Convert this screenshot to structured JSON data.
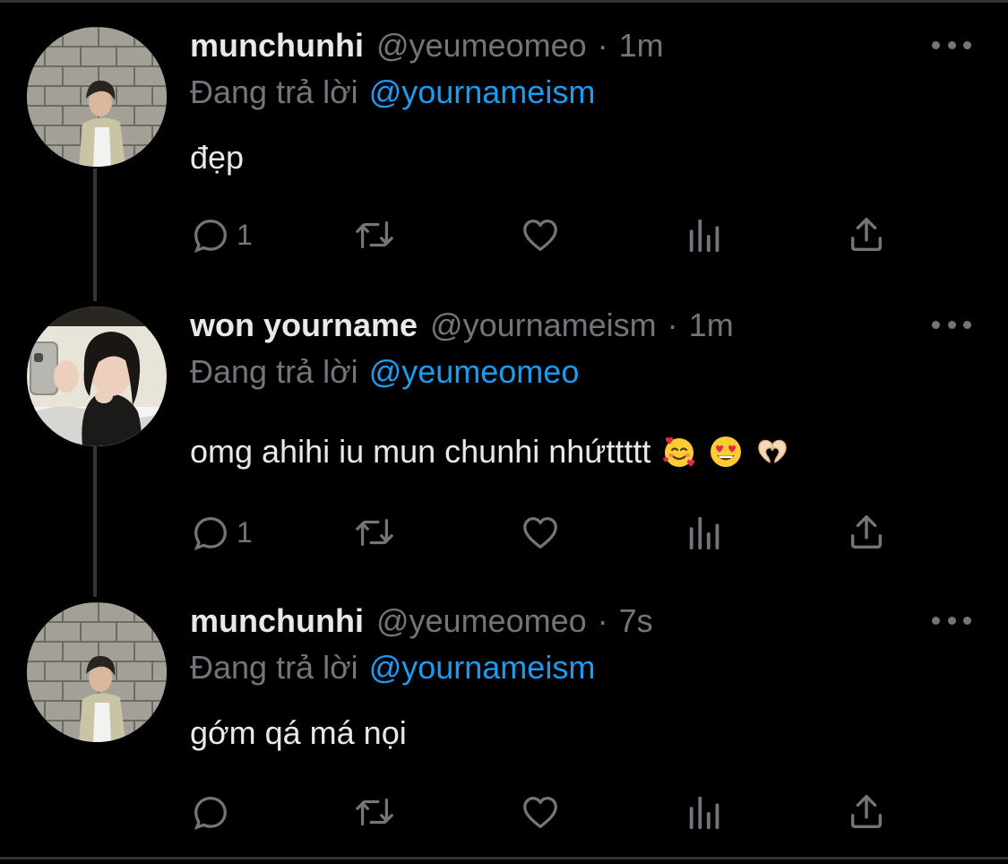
{
  "reply_prefix": "Đang trả lời",
  "tweets": [
    {
      "name": "munchunhi",
      "handle": "@yeumeomeo",
      "dot": "·",
      "time": "1m",
      "reply_to": "@yournameism",
      "text": "đẹp",
      "reply_count": "1",
      "avatar": "avatar-boy-photo"
    },
    {
      "name": "won yourname",
      "handle": "@yournameism",
      "dot": "·",
      "time": "1m",
      "reply_to": "@yeumeomeo",
      "text": "omg ahihi iu mun chunhi nhứttttt",
      "emojis": [
        "smiling-face-with-hearts",
        "heart-eyes",
        "heart-hands"
      ],
      "reply_count": "1",
      "avatar": "avatar-girl-photo"
    },
    {
      "name": "munchunhi",
      "handle": "@yeumeomeo",
      "dot": "·",
      "time": "7s",
      "reply_to": "@yournameism",
      "text": "gớm qá má nọi",
      "reply_count": "",
      "avatar": "avatar-boy-photo"
    }
  ],
  "colors": {
    "background": "#000000",
    "text": "#e7e9ea",
    "muted": "#71767b",
    "accent": "#1d9bf0"
  },
  "icons": [
    "reply-icon",
    "retweet-icon",
    "like-icon",
    "views-icon",
    "share-icon",
    "more-icon"
  ]
}
